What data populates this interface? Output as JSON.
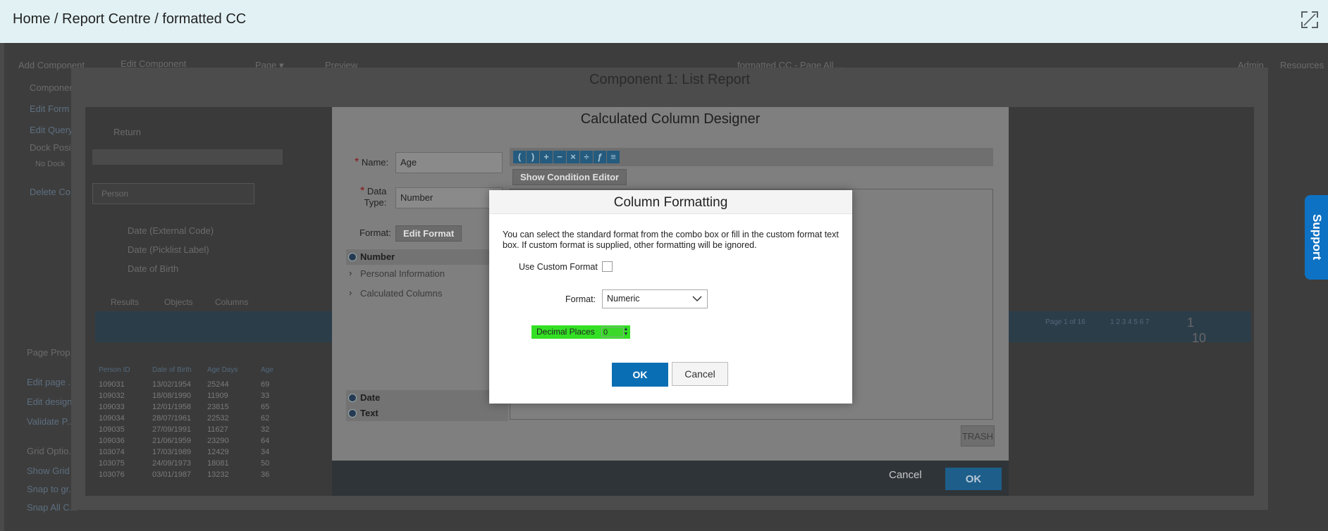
{
  "header": {
    "breadcrumb": "Home / Report Centre / formatted CC",
    "fullscreen_icon": "expand-icon"
  },
  "background": {
    "menu": [
      "Add Component",
      "Edit Component",
      "Page ▾",
      "Preview"
    ],
    "center_title": "formatted CC - Page All ...",
    "right_menu": [
      "Admin",
      "Resources"
    ],
    "left_items": [
      "Component",
      "Edit Form",
      "Edit Query",
      "Dock Position",
      "No Dock",
      "Delete Co..."
    ],
    "left_lower": [
      "Page Prop...",
      "Edit page ...",
      "Edit design...",
      "Validate P...",
      "Grid Optio...",
      "Show Grid",
      "Snap to gr...",
      "Snap All C..."
    ],
    "return_label": "Return",
    "search_placeholder": "Person",
    "fields": [
      "Date (External Code)",
      "Date (Picklist Label)",
      "Date of Birth"
    ],
    "tabs": [
      "Results",
      "Objects",
      "Columns"
    ],
    "paging": "Page 1 of 16",
    "page_numbers": "1 2 3 4 5 6 7",
    "page_input": "1",
    "page_size": "10",
    "grid_headers": [
      "Person ID",
      "Date of Birth",
      "Age Days",
      "Age"
    ],
    "grid_rows": [
      [
        "109031",
        "13/02/1954",
        "25244",
        "69"
      ],
      [
        "109032",
        "18/08/1990",
        "11909",
        "33"
      ],
      [
        "109033",
        "12/01/1958",
        "23815",
        "65"
      ],
      [
        "109034",
        "28/07/1961",
        "22532",
        "62"
      ],
      [
        "109035",
        "27/09/1991",
        "11627",
        "32"
      ],
      [
        "109036",
        "21/06/1959",
        "23290",
        "64"
      ],
      [
        "103074",
        "17/03/1989",
        "12429",
        "34"
      ],
      [
        "103075",
        "24/09/1973",
        "18081",
        "50"
      ],
      [
        "103076",
        "03/01/1987",
        "13232",
        "36"
      ]
    ]
  },
  "component_panel": {
    "title": "Component 1: List Report"
  },
  "ccd": {
    "title": "Calculated Column Designer",
    "name_label": "Name:",
    "name_value": "Age",
    "datatype_label_1": "Data",
    "datatype_label_2": "Type:",
    "datatype_value": "Number",
    "format_label": "Format:",
    "edit_format_label": "Edit Format",
    "show_condition_label": "Show Condition Editor",
    "tree": [
      {
        "label": "Number",
        "kind": "head"
      },
      {
        "label": "Personal Information",
        "kind": "folder"
      },
      {
        "label": "Calculated Columns",
        "kind": "folder"
      },
      {
        "label": "Date",
        "kind": "head"
      },
      {
        "label": "Text",
        "kind": "head"
      }
    ],
    "toolbar_icons": [
      "parens-open-icon",
      "parens-close-icon",
      "plus-icon",
      "minus-icon",
      "multiply-icon",
      "divide-icon",
      "function-icon",
      "expression-icon"
    ],
    "trash_label": "TRASH",
    "cancel_label": "Cancel",
    "ok_label": "OK"
  },
  "column_formatting": {
    "title": "Column Formatting",
    "description": "You can select the standard format from the combo box or fill in the custom format text box. If custom format is supplied, other formatting will be ignored.",
    "use_custom_label": "Use Custom Format",
    "format_label": "Format:",
    "format_value": "Numeric",
    "decimal_label": "Decimal Places",
    "decimal_value": "0",
    "ok_label": "OK",
    "cancel_label": "Cancel"
  },
  "support": {
    "label": "Support"
  },
  "colors": {
    "header_bg": "#e2f1f4",
    "primary_button": "#0a6eb4",
    "decimal_highlight": "#33e024",
    "support_tab": "#0d72c4"
  }
}
